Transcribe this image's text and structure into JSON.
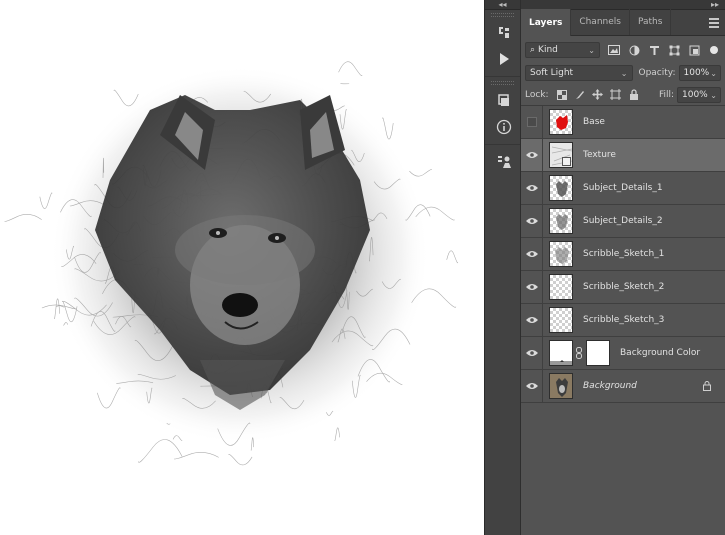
{
  "panel": {
    "tabs": [
      {
        "label": "Layers"
      },
      {
        "label": "Channels"
      },
      {
        "label": "Paths"
      }
    ],
    "filter": {
      "kind_label": "Kind"
    },
    "blend_mode": "Soft Light",
    "opacity_label": "Opacity:",
    "opacity_value": "100%",
    "lock_label": "Lock:",
    "fill_label": "Fill:",
    "fill_value": "100%"
  },
  "layers": [
    {
      "name": "Base",
      "visible": false,
      "thumb": "red-figure"
    },
    {
      "name": "Texture",
      "visible": true,
      "thumb": "texture",
      "selected": true
    },
    {
      "name": "Subject_Details_1",
      "visible": true,
      "thumb": "checker-wolf"
    },
    {
      "name": "Subject_Details_2",
      "visible": true,
      "thumb": "checker-wolf"
    },
    {
      "name": "Scribble_Sketch_1",
      "visible": true,
      "thumb": "checker-wolf"
    },
    {
      "name": "Scribble_Sketch_2",
      "visible": true,
      "thumb": "checker"
    },
    {
      "name": "Scribble_Sketch_3",
      "visible": true,
      "thumb": "checker"
    },
    {
      "name": "Background Color",
      "visible": true,
      "thumb": "white-with-mask"
    },
    {
      "name": "Background",
      "visible": true,
      "thumb": "photo",
      "locked": true
    }
  ],
  "icons": {
    "tools": [
      "history-icon",
      "play-icon",
      "3d-layers-icon",
      "info-icon",
      "clone-source-icon"
    ],
    "filter": [
      "image-filter-icon",
      "adjustment-filter-icon",
      "type-filter-icon",
      "shape-filter-icon",
      "smart-object-filter-icon"
    ],
    "lock": [
      "lock-transparent-icon",
      "lock-paint-icon",
      "lock-position-icon",
      "lock-artboard-icon",
      "lock-all-icon"
    ]
  },
  "colors": {
    "panel_bg": "#535353",
    "selected_row": "#6b6b6b",
    "accent_red": "#e01010"
  }
}
